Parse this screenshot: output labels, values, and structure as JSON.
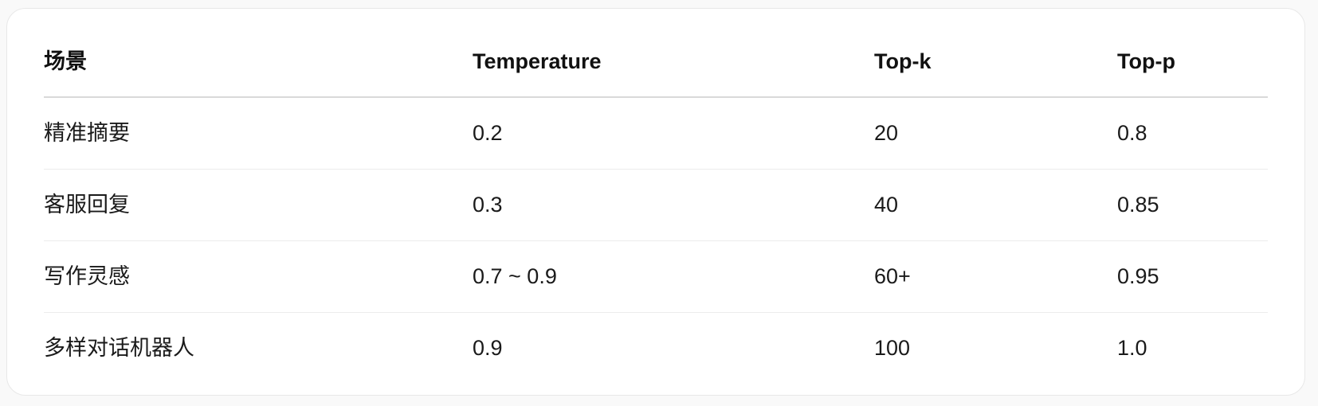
{
  "table": {
    "headers": [
      "场景",
      "Temperature",
      "Top-k",
      "Top-p"
    ],
    "rows": [
      [
        "精准摘要",
        "0.2",
        "20",
        "0.8"
      ],
      [
        "客服回复",
        "0.3",
        "40",
        "0.85"
      ],
      [
        "写作灵感",
        "0.7 ~ 0.9",
        "60+",
        "0.95"
      ],
      [
        "多样对话机器人",
        "0.9",
        "100",
        "1.0"
      ]
    ]
  }
}
